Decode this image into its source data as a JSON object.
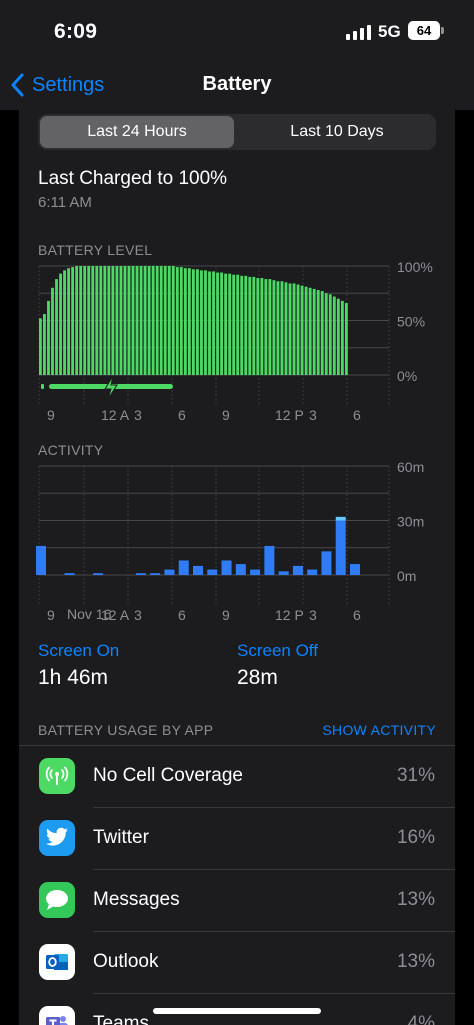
{
  "status": {
    "time": "6:09",
    "network": "5G",
    "battery": "64"
  },
  "nav": {
    "back_label": "Settings",
    "title": "Battery"
  },
  "tabs": [
    {
      "label": "Last 24 Hours",
      "selected": true
    },
    {
      "label": "Last 10 Days",
      "selected": false
    }
  ],
  "last_charged": {
    "title": "Last Charged to 100%",
    "time": "6:11 AM"
  },
  "battery_level_label": "BATTERY LEVEL",
  "activity_label": "ACTIVITY",
  "chart_data": [
    {
      "type": "bar",
      "title": "BATTERY LEVEL",
      "x_tick_labels": [
        "9",
        "12 A",
        "3",
        "6",
        "9",
        "12 P",
        "3",
        "6"
      ],
      "y_tick_labels": [
        "100%",
        "50%",
        "0%"
      ],
      "ylim": [
        0,
        100
      ],
      "grid": true,
      "color": "#4cd964",
      "charging_indicator": true,
      "values": [
        52,
        56,
        68,
        80,
        88,
        93,
        96,
        98,
        99,
        100,
        100,
        100,
        100,
        100,
        100,
        100,
        100,
        100,
        100,
        100,
        100,
        100,
        100,
        100,
        100,
        100,
        100,
        100,
        100,
        100,
        100,
        100,
        100,
        100,
        99,
        99,
        98,
        98,
        97,
        97,
        96,
        96,
        95,
        95,
        94,
        94,
        93,
        93,
        92,
        92,
        91,
        91,
        90,
        90,
        89,
        89,
        88,
        88,
        87,
        86,
        86,
        85,
        84,
        84,
        83,
        82,
        81,
        80,
        79,
        78,
        77,
        75,
        74,
        72,
        70,
        68,
        66
      ]
    },
    {
      "type": "bar",
      "title": "ACTIVITY",
      "x_tick_labels": [
        "9",
        "12 A",
        "3",
        "6",
        "9",
        "12 P",
        "3",
        "6"
      ],
      "date_label": "Nov 16",
      "y_tick_labels": [
        "60m",
        "30m",
        "0m"
      ],
      "ylim": [
        0,
        60
      ],
      "grid": true,
      "series": [
        {
          "name": "Screen On",
          "color": "#2f7cf6",
          "values": [
            16,
            0,
            1,
            0,
            1,
            0,
            0,
            1,
            1,
            3,
            8,
            5,
            3,
            8,
            6,
            3,
            16,
            2,
            5,
            3,
            13,
            30,
            6
          ]
        },
        {
          "name": "Screen Off",
          "color": "#64c8ff",
          "values": [
            0,
            0,
            0,
            0,
            0,
            0,
            0,
            0,
            0,
            0,
            0,
            0,
            0,
            0,
            0,
            0,
            0,
            0,
            0,
            0,
            0,
            2,
            0
          ]
        }
      ]
    }
  ],
  "stats": [
    {
      "label": "Screen On",
      "value": "1h 46m"
    },
    {
      "label": "Screen Off",
      "value": "28m"
    }
  ],
  "usage": {
    "title": "BATTERY USAGE BY APP",
    "action": "SHOW ACTIVITY",
    "apps": [
      {
        "name": "No Cell Coverage",
        "percent": "31%",
        "icon": "antenna-icon",
        "color": "#4cd964"
      },
      {
        "name": "Twitter",
        "percent": "16%",
        "icon": "twitter-bird-icon",
        "color": "#1d9bf0"
      },
      {
        "name": "Messages",
        "percent": "13%",
        "icon": "message-bubble-icon",
        "color": "#34c759"
      },
      {
        "name": "Outlook",
        "percent": "13%",
        "icon": "outlook-icon",
        "color": "#ffffff"
      },
      {
        "name": "Teams",
        "percent": "4%",
        "icon": "teams-icon",
        "color": "#5b5fc7"
      }
    ]
  }
}
